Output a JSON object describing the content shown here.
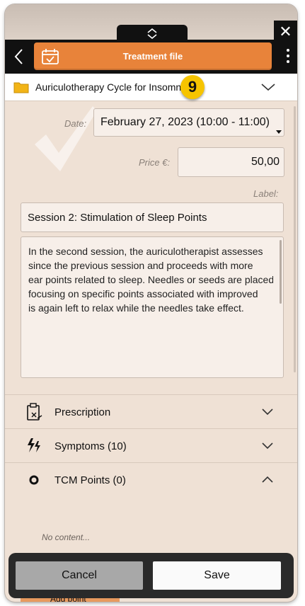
{
  "header": {
    "title": "Treatment file"
  },
  "cycle": {
    "name": "Auriculotherapy Cycle for Insomnia",
    "badge": "9"
  },
  "form": {
    "date_label": "Date:",
    "date_value": "February 27, 2023 (10:00 - 11:00)",
    "price_label": "Price €:",
    "price_value": "50,00",
    "label_label": "Label:",
    "label_value": "Session 2: Stimulation of Sleep Points",
    "notes": "In the second session, the auriculotherapist assesses\nsince the previous session and proceeds with more\near points related to sleep. Needles or seeds are placed\nfocusing on specific points associated with improved\nis again left to relax while the needles take effect."
  },
  "sections": {
    "prescription": "Prescription",
    "symptoms": "Symptoms (10)",
    "tcm_points": "TCM Points (0)"
  },
  "empty_state": "No content...",
  "add_point": "Add point",
  "footer": {
    "cancel": "Cancel",
    "save": "Save"
  },
  "colors": {
    "accent": "#e8833a",
    "background": "#efe1d5",
    "badge": "#f6c400"
  }
}
